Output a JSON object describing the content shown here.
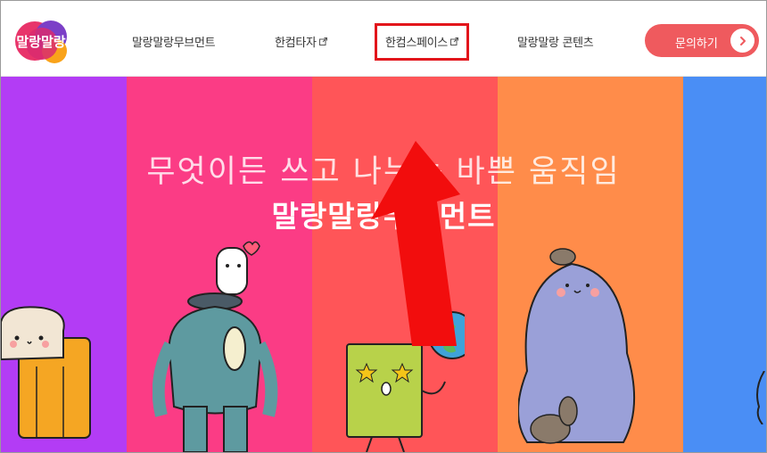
{
  "header": {
    "logo_text": "말랑말랑",
    "nav": [
      {
        "label": "말랑말랑무브먼트",
        "external": false
      },
      {
        "label": "한컴타자",
        "external": true
      },
      {
        "label": "한컴스페이스",
        "external": true
      },
      {
        "label": "말랑말랑 콘텐츠",
        "external": false
      }
    ],
    "cta_label": "문의하기"
  },
  "hero": {
    "line1": "무엇이든 쓰고 나누는 바쁜 움직임",
    "line2": "말랑말랑무브먼트",
    "stripe_colors": [
      "#b33cf5",
      "#fb3c85",
      "#ff5558",
      "#ff8c4a",
      "#4a8ef5"
    ]
  },
  "annotation": {
    "highlight_color": "#e2151b",
    "arrow_color": "#f20d0d"
  }
}
